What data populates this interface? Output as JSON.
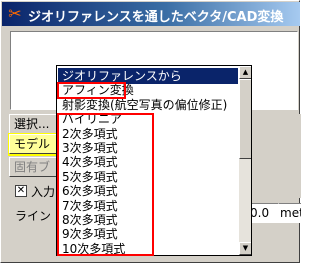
{
  "window": {
    "title": "ジオリファレンスを通したベクタ/CAD変換"
  },
  "buttons": {
    "select_label": "選択...",
    "model_label": "モデル",
    "disabled_label": "固有ブ"
  },
  "checkbox": {
    "label": "入力",
    "checked": true
  },
  "line_label": "ライン",
  "value_field": "0.0",
  "unit_field": "met",
  "dropdown": {
    "items": [
      "ジオリファレンスから",
      "アフィン変換",
      "射影変換(航空写真の偏位修正)",
      "バイリニア",
      "2次多項式",
      "3次多項式",
      "4次多項式",
      "5次多項式",
      "6次多項式",
      "7次多項式",
      "8次多項式",
      "9次多項式",
      "10次多項式"
    ],
    "selected_index": 0
  },
  "annotations": {
    "highlight_color": "#ff0000",
    "model_highlight_color": "#ffff00"
  }
}
